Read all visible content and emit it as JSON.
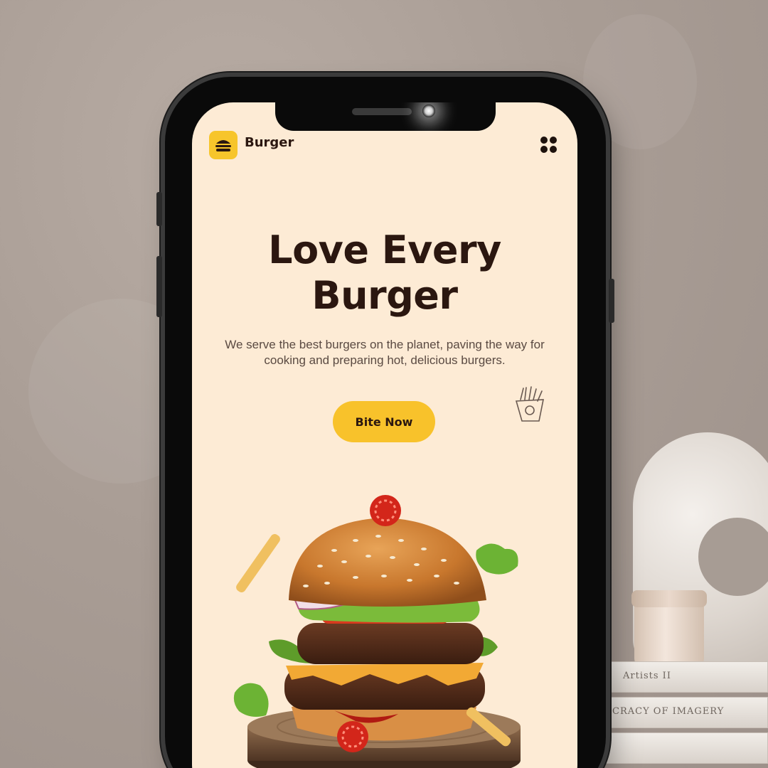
{
  "app": {
    "brand_name": "Burger",
    "logo_icon": "burger-icon",
    "menu_icon": "grid-menu-icon"
  },
  "hero": {
    "headline_line1": "Love Every",
    "headline_line2": "Burger",
    "description": "We serve the best burgers on the planet, paving the way for cooking and preparing hot, delicious burgers.",
    "cta_label": "Bite Now",
    "decor_icon": "fries-icon",
    "image": "burger-on-wooden-board"
  },
  "background": {
    "book_spines": [
      "Artists II",
      "CRACY OF IMAGERY"
    ]
  },
  "colors": {
    "screen_bg": "#fdebd5",
    "accent": "#f8c22b",
    "text_dark": "#2b1710"
  }
}
